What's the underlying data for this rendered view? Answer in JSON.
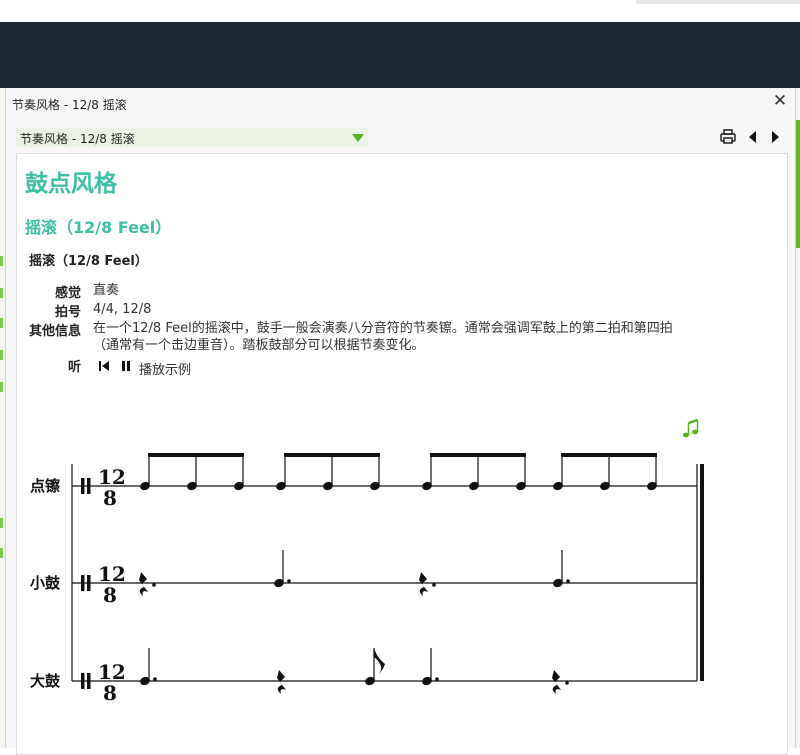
{
  "dialog": {
    "title": "节奏风格 - 12/8 摇滚",
    "topic_select": "节奏风格 - 12/8 摇滚"
  },
  "content": {
    "h1": "鼓点风格",
    "h2": "摇滚（12/8 Feel）",
    "h3": "摇滚（12/8 Feel）",
    "info": [
      {
        "label": "感觉",
        "value": "直奏"
      },
      {
        "label": "拍号",
        "value": "4/4, 12/8"
      },
      {
        "label": "其他信息",
        "value": "在一个12/8 Feel的摇滚中，鼓手一般会演奏八分音符的节奏镲。通常会强调军鼓上的第二拍和第四拍（通常有一个击边重音）。踏板鼓部分可以根据节奏变化。"
      },
      {
        "label": "听",
        "value": ""
      }
    ],
    "play_example": "播放示例"
  },
  "score": {
    "time_signature": {
      "top": "12",
      "bottom": "8"
    },
    "staves": [
      {
        "name": "点镲"
      },
      {
        "name": "小鼓"
      },
      {
        "name": "大鼓"
      }
    ]
  },
  "icons": {
    "close": "close-icon",
    "print": "print-icon",
    "prev": "triangle-left-icon",
    "next": "triangle-right-icon",
    "music_note": "music-note-icon"
  },
  "colors": {
    "heading": "#3cbfa5",
    "accent_green": "#5bb21d",
    "app_bar": "#1d2a32"
  }
}
